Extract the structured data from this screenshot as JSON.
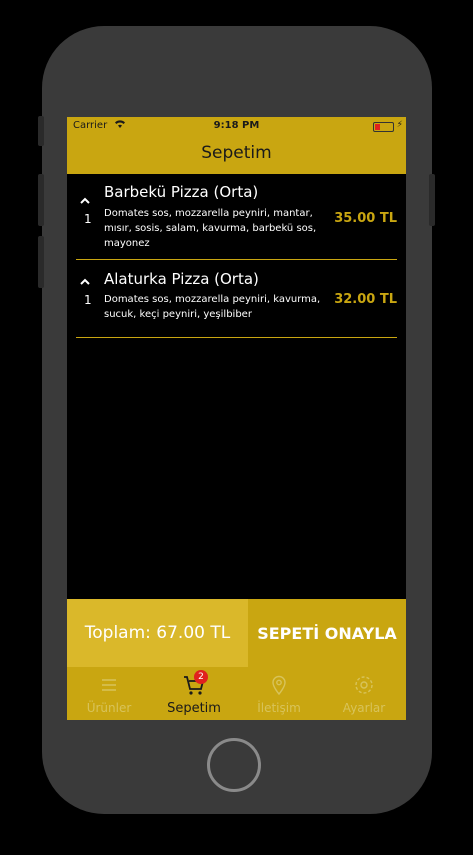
{
  "status": {
    "carrier": "Carrier",
    "time": "9:18 PM"
  },
  "header": {
    "title": "Sepetim"
  },
  "cart": {
    "items": [
      {
        "name": "Barbekü Pizza (Orta)",
        "quantity": "1",
        "description": "Domates sos, mozzarella peyniri, mantar, mısır, sosis, salam, kavurma, barbekü sos, mayonez",
        "price": "35.00 TL"
      },
      {
        "name": "Alaturka Pizza (Orta)",
        "quantity": "1",
        "description": "Domates sos, mozzarella peyniri, kavurma, sucuk, keçi peyniri, yeşilbiber",
        "price": "32.00 TL"
      }
    ],
    "total": "Toplam: 67.00 TL",
    "confirm_label": "SEPETİ ONAYLA"
  },
  "tabs": [
    {
      "label": "Ürünler",
      "icon": "menu-icon"
    },
    {
      "label": "Sepetim",
      "icon": "cart-icon",
      "badge": "2"
    },
    {
      "label": "İletişim",
      "icon": "location-icon"
    },
    {
      "label": "Ayarlar",
      "icon": "gear-icon"
    }
  ],
  "colors": {
    "accent": "#c9a611",
    "badge": "#e0211e",
    "background": "#000000"
  }
}
